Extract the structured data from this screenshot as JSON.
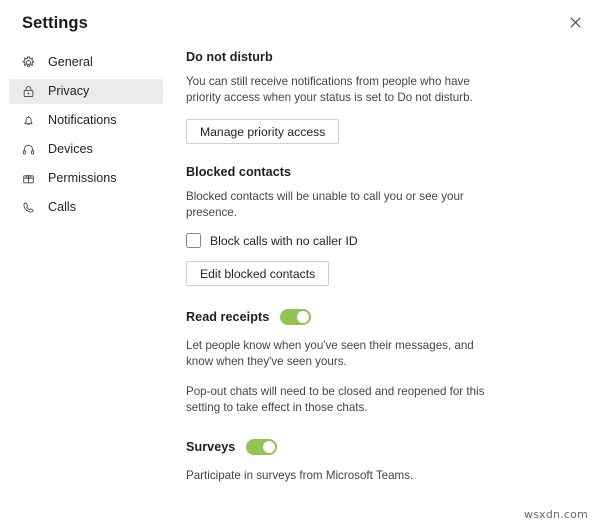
{
  "window": {
    "title": "Settings",
    "close_icon": "close-icon"
  },
  "sidebar": {
    "items": [
      {
        "label": "General",
        "icon": "gear-icon",
        "selected": false
      },
      {
        "label": "Privacy",
        "icon": "lock-icon",
        "selected": true
      },
      {
        "label": "Notifications",
        "icon": "bell-icon",
        "selected": false
      },
      {
        "label": "Devices",
        "icon": "headset-icon",
        "selected": false
      },
      {
        "label": "Permissions",
        "icon": "permissions-icon",
        "selected": false
      },
      {
        "label": "Calls",
        "icon": "phone-icon",
        "selected": false
      }
    ]
  },
  "content": {
    "do_not_disturb": {
      "heading": "Do not disturb",
      "description": "You can still receive notifications from people who have priority access when your status is set to Do not disturb.",
      "button_label": "Manage priority access"
    },
    "blocked_contacts": {
      "heading": "Blocked contacts",
      "description": "Blocked contacts will be unable to call you or see your presence.",
      "checkbox_label": "Block calls with no caller ID",
      "checkbox_checked": "false",
      "button_label": "Edit blocked contacts"
    },
    "read_receipts": {
      "heading": "Read receipts",
      "toggle_state": "on",
      "description_1": "Let people know when you've seen their messages, and know when they've seen yours.",
      "description_2": "Pop-out chats will need to be closed and reopened for this setting to take effect in those chats."
    },
    "surveys": {
      "heading": "Surveys",
      "toggle_state": "on",
      "description": "Participate in surveys from Microsoft Teams."
    }
  },
  "watermark": {
    "text": "wsxdn.com"
  },
  "colors": {
    "toggle_on": "#92c353",
    "selected_row": "#ebebeb",
    "text_primary": "#252423",
    "text_secondary": "#484644",
    "border": "#d2d0ce"
  }
}
